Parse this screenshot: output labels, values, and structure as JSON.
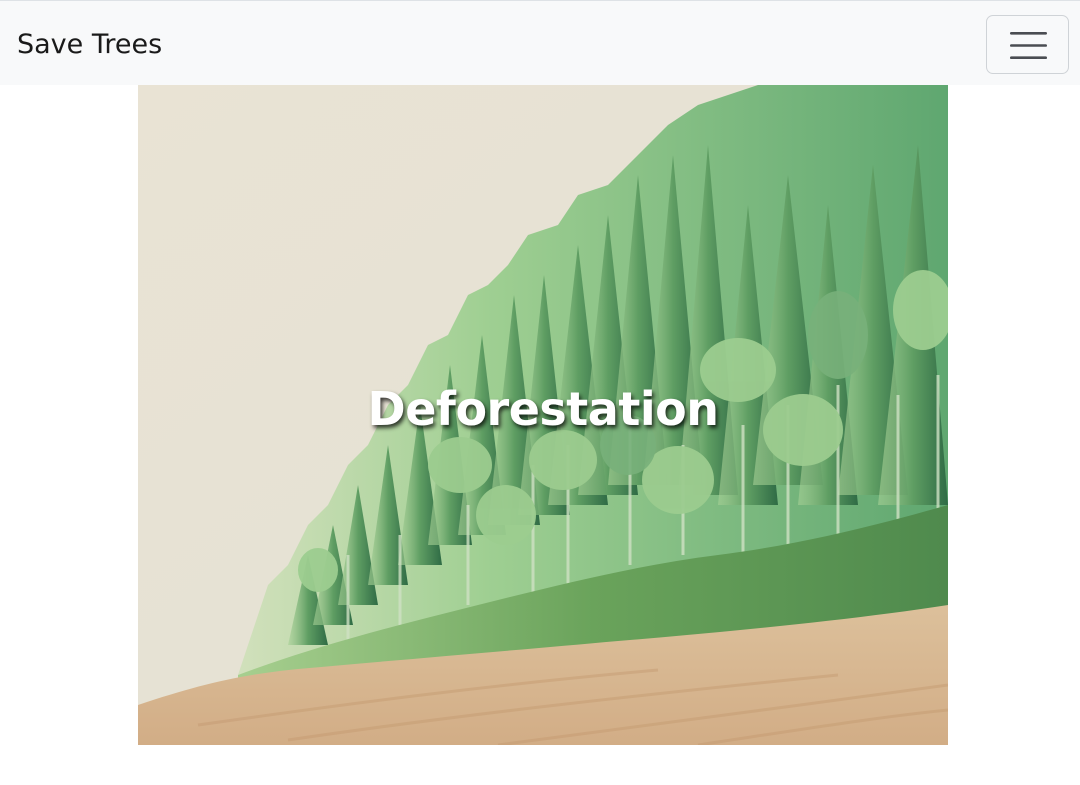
{
  "navbar": {
    "brand": "Save Trees",
    "toggler_icon": "hamburger-menu-icon"
  },
  "hero": {
    "title": "Deforestation",
    "image_subject": "illustrated forest edge of green conifers and deciduous trees bordering bare sandy cleared land"
  },
  "colors": {
    "navbar_bg": "#f8f9fa",
    "sky": "#e8e2d3",
    "forest_dark": "#3f7a4a",
    "forest_light": "#8fc58a",
    "soil": "#d9b893",
    "title_text": "#ffffff"
  }
}
